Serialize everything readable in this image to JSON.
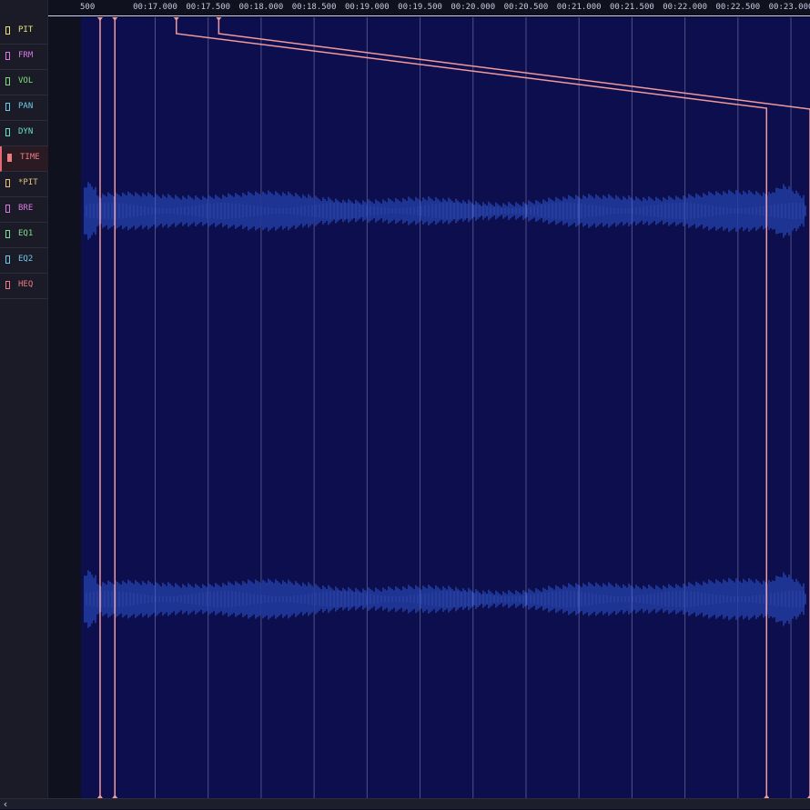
{
  "params": [
    {
      "id": "pit",
      "label": "PIT",
      "color": "#e8e27a",
      "active": false
    },
    {
      "id": "frm",
      "label": "FRM",
      "color": "#d57ae6",
      "active": false
    },
    {
      "id": "vol",
      "label": "VOL",
      "color": "#7be07a",
      "active": false
    },
    {
      "id": "pan",
      "label": "PAN",
      "color": "#6ecbe8",
      "active": false
    },
    {
      "id": "dyn",
      "label": "DYN",
      "color": "#6be0c8",
      "active": false
    },
    {
      "id": "time",
      "label": "TIME",
      "color": "#ef7a82",
      "active": true
    },
    {
      "id": "star-pit",
      "label": "*PIT",
      "color": "#e8c27a",
      "active": false
    },
    {
      "id": "bre",
      "label": "BRE",
      "color": "#d77ae0",
      "active": false
    },
    {
      "id": "eq1",
      "label": "EQ1",
      "color": "#7ee08c",
      "active": false
    },
    {
      "id": "eq2",
      "label": "EQ2",
      "color": "#72c7ea",
      "active": false
    },
    {
      "id": "heq",
      "label": "HEQ",
      "color": "#ef7a86",
      "active": false
    }
  ],
  "ruler": {
    "cut_label": "500",
    "ticks": [
      {
        "label": "00:17.000",
        "t": 17.0
      },
      {
        "label": "00:17.500",
        "t": 17.5
      },
      {
        "label": "00:18.000",
        "t": 18.0
      },
      {
        "label": "00:18.500",
        "t": 18.5
      },
      {
        "label": "00:19.000",
        "t": 19.0
      },
      {
        "label": "00:19.500",
        "t": 19.5
      },
      {
        "label": "00:20.000",
        "t": 20.0
      },
      {
        "label": "00:20.500",
        "t": 20.5
      },
      {
        "label": "00:21.000",
        "t": 21.0
      },
      {
        "label": "00:21.500",
        "t": 21.5
      },
      {
        "label": "00:22.000",
        "t": 22.0
      },
      {
        "label": "00:22.500",
        "t": 22.5
      },
      {
        "label": "00:23.000",
        "t": 23.0
      }
    ]
  },
  "timeline": {
    "visible_start": 16.3,
    "visible_end": 23.18
  },
  "time_markers": [
    {
      "id": "marker-1",
      "src": 16.48,
      "dst": 16.48
    },
    {
      "id": "marker-2",
      "src": 16.62,
      "dst": 16.62
    },
    {
      "id": "marker-3",
      "src": 17.2,
      "dst": 22.77
    },
    {
      "id": "marker-4",
      "src": 17.6,
      "dst": 23.18
    }
  ],
  "colors": {
    "editor_bg": "#0d0e4e",
    "grid_line": "#5a5d92",
    "marker": "#f09a9a",
    "waveform": "#2f5ad8",
    "waveform_hi": "#4a78ff"
  }
}
